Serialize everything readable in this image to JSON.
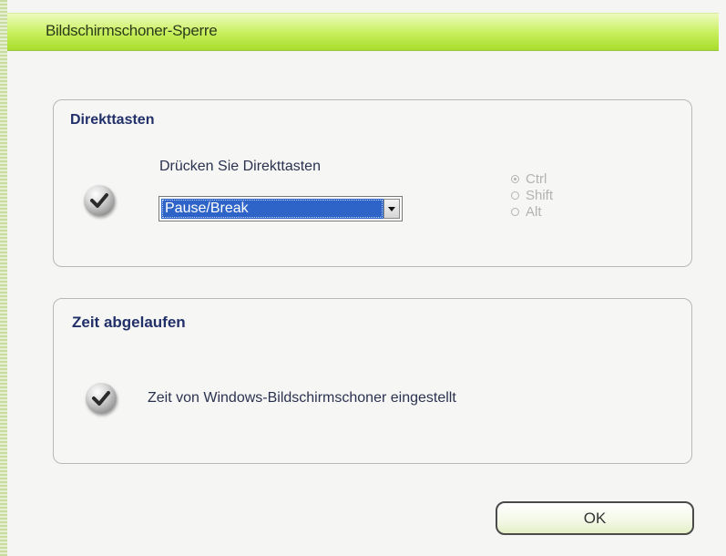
{
  "window": {
    "title": "Bildschirmschoner-Sperre"
  },
  "hotkeys": {
    "title": "Direkttasten",
    "prompt": "Drücken Sie Direkttasten",
    "selected_key": "Pause/Break",
    "modifiers": [
      {
        "label": "Ctrl",
        "checked": true
      },
      {
        "label": "Shift",
        "checked": false
      },
      {
        "label": "Alt",
        "checked": false
      }
    ]
  },
  "timeout": {
    "title": "Zeit abgelaufen",
    "text": "Zeit von Windows-Bildschirmschoner eingestellt"
  },
  "buttons": {
    "ok_label": "OK"
  },
  "colors": {
    "titlebar": "#b4e23c",
    "group_title": "#22306a",
    "selection": "#2e63c8"
  }
}
